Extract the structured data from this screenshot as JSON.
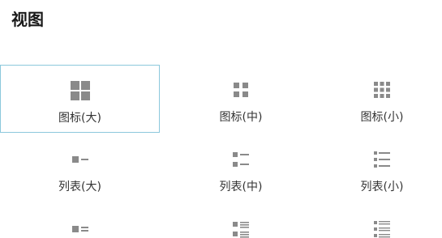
{
  "panel": {
    "title": "视图"
  },
  "colors": {
    "icon": "#8a8a8a",
    "selected_border": "#8cc8dc"
  },
  "options": [
    {
      "label": "图标(大)",
      "icon": "large-icons-icon",
      "selected": true
    },
    {
      "label": "图标(中)",
      "icon": "medium-icons-icon",
      "selected": false
    },
    {
      "label": "图标(小)",
      "icon": "small-icons-icon",
      "selected": false
    },
    {
      "label": "列表(大)",
      "icon": "large-list-icon",
      "selected": false
    },
    {
      "label": "列表(中)",
      "icon": "medium-list-icon",
      "selected": false
    },
    {
      "label": "列表(小)",
      "icon": "small-list-icon",
      "selected": false
    },
    {
      "label": "",
      "icon": "large-details-icon",
      "selected": false
    },
    {
      "label": "",
      "icon": "medium-details-icon",
      "selected": false
    },
    {
      "label": "",
      "icon": "small-details-icon",
      "selected": false
    }
  ]
}
